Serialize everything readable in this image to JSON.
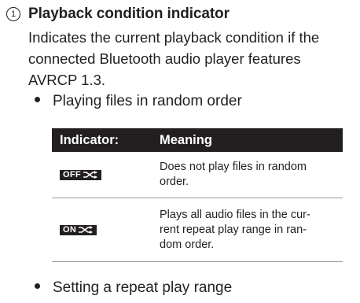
{
  "section": {
    "number": "1",
    "heading": "Playback condition indicator",
    "description_lines": [
      "Indicates the current playback condition if the",
      "connected Bluetooth audio player features",
      "AVRCP 1.3."
    ]
  },
  "bullets": [
    "Playing files in random order",
    "Setting a repeat play range"
  ],
  "table": {
    "headers": [
      "Indicator:",
      "Meaning"
    ],
    "rows": [
      {
        "indicator": "OFF",
        "indicator_icon": "random-icon",
        "meaning_lines": [
          "Does not play files in random",
          "order."
        ]
      },
      {
        "indicator": "ON",
        "indicator_icon": "random-icon",
        "meaning_lines": [
          "Plays all audio files in the cur-",
          "rent repeat play range in ran-",
          "dom order."
        ]
      }
    ]
  }
}
